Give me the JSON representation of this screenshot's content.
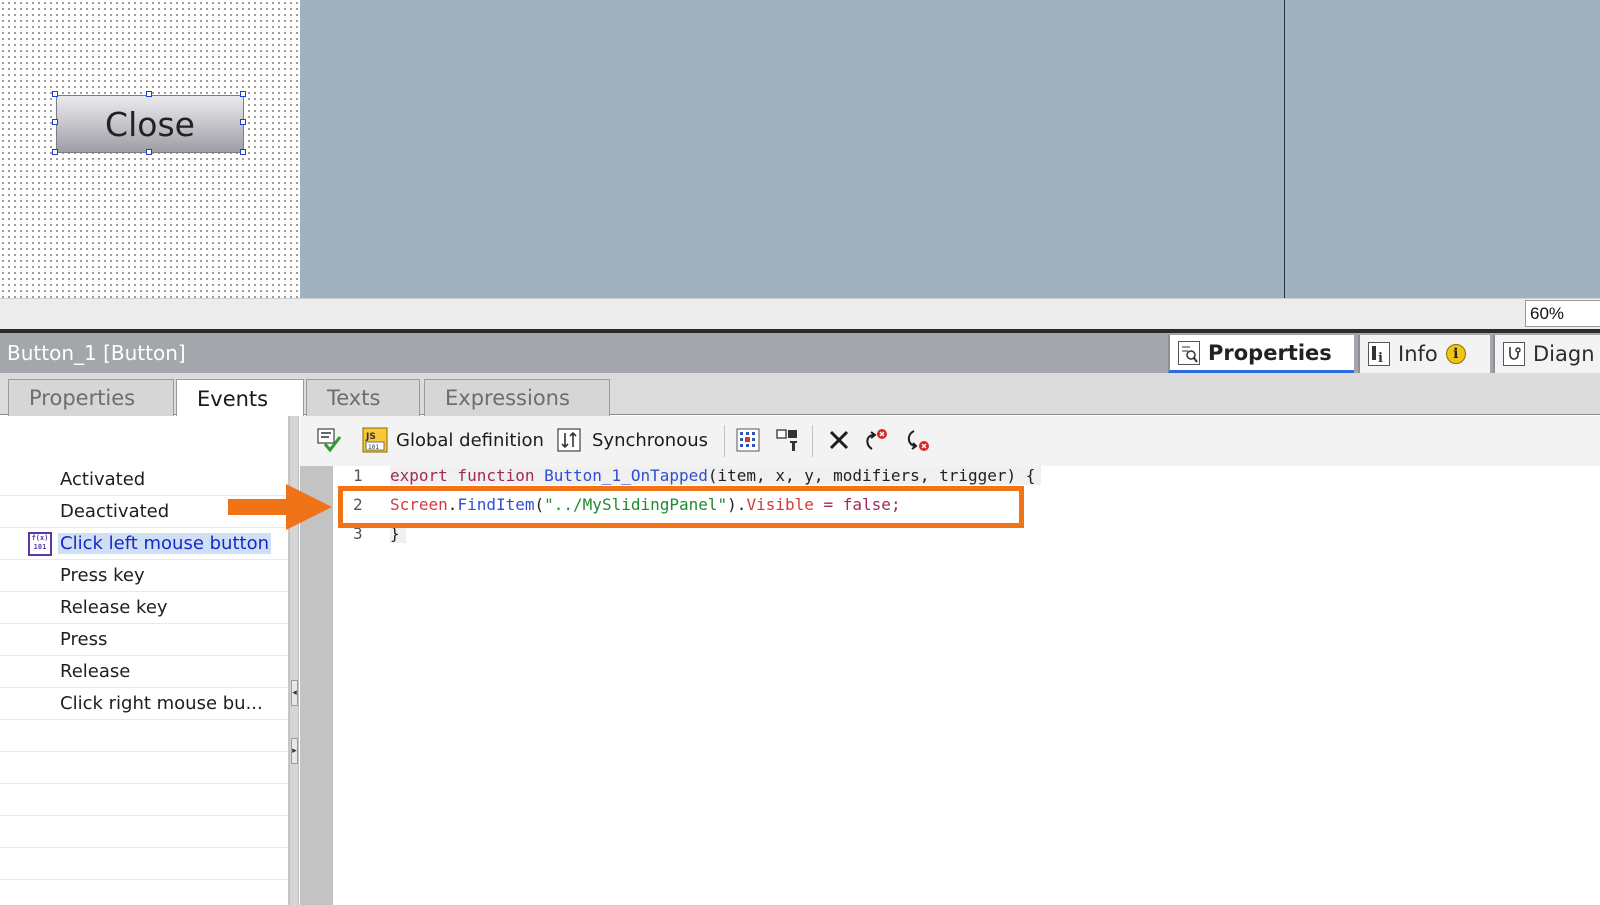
{
  "canvas": {
    "button_label": "Close",
    "zoom": "60%"
  },
  "inspector": {
    "title": "Button_1 [Button]",
    "side_tabs": [
      {
        "label": "Properties",
        "icon": "magnifier-properties-icon"
      },
      {
        "label": "Info",
        "icon": "info-icon"
      },
      {
        "label": "Diagn",
        "icon": "diagnostics-icon"
      }
    ],
    "tabs": [
      "Properties",
      "Events",
      "Texts",
      "Expressions"
    ],
    "active_tab": "Events"
  },
  "events": {
    "items": [
      "Activated",
      "Deactivated",
      "Click left mouse button",
      "Press key",
      "Release key",
      "Press",
      "Release",
      "Click right mouse bu..."
    ],
    "selected": "Click left mouse button"
  },
  "toolbar": {
    "global_definition": "Global definition",
    "synchronous": "Synchronous"
  },
  "code": {
    "line_numbers": [
      "1",
      "2",
      "3"
    ],
    "line1": {
      "kw": "export function ",
      "name": "Button_1_OnTapped",
      "args": "(item, x, y, modifiers, trigger) {"
    },
    "line2": {
      "obj": "Screen",
      "dot1": ".",
      "method": "FindItem",
      "open": "(",
      "str": "\"../MySlidingPanel\"",
      "close": ").",
      "prop": "Visible",
      "rest": " = false;"
    },
    "line3": "}"
  },
  "colors": {
    "highlight": "#f07318",
    "selected_event_text": "#1a26c8",
    "canvas_bg": "#9fb0bf"
  }
}
